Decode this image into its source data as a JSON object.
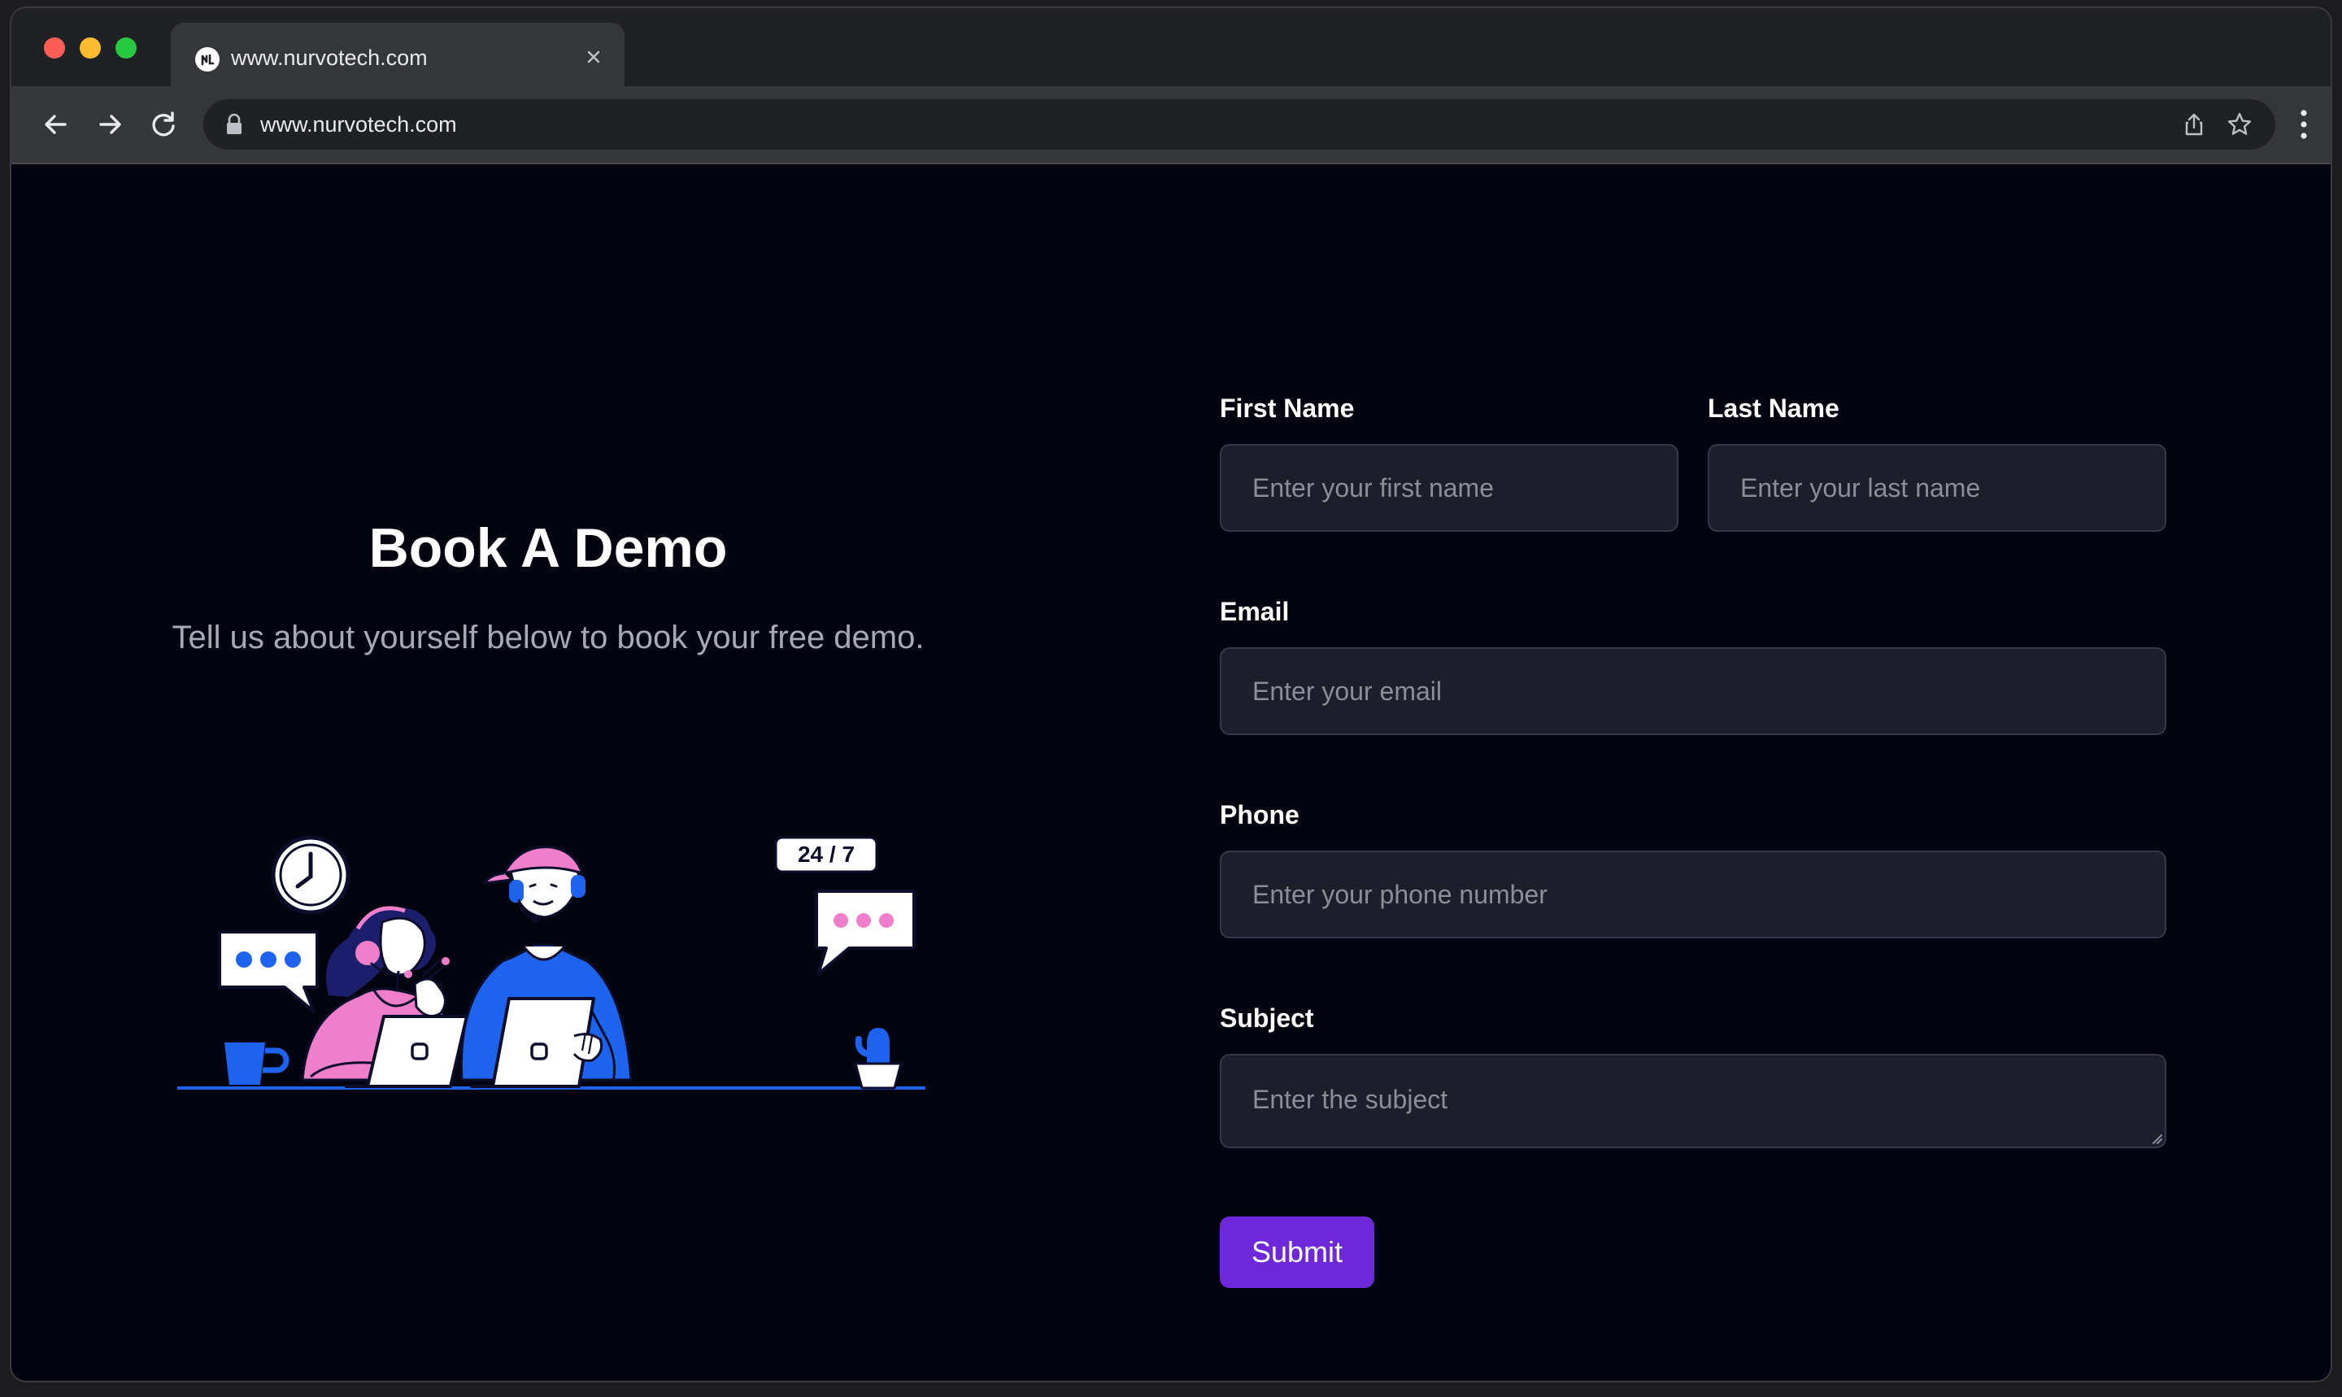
{
  "browser": {
    "tab_title": "www.nurvotech.com",
    "url": "www.nurvotech.com"
  },
  "hero": {
    "title": "Book A Demo",
    "subtitle": "Tell us about yourself below to book your free demo.",
    "illustration_badge": "24 / 7"
  },
  "form": {
    "first_name": {
      "label": "First Name",
      "value": "",
      "placeholder": "Enter your first name"
    },
    "last_name": {
      "label": "Last Name",
      "value": "",
      "placeholder": "Enter your last name"
    },
    "email": {
      "label": "Email",
      "value": "",
      "placeholder": "Enter your email"
    },
    "phone": {
      "label": "Phone",
      "value": "",
      "placeholder": "Enter your phone number"
    },
    "subject": {
      "label": "Subject",
      "value": "",
      "placeholder": "Enter the subject"
    },
    "submit_label": "Submit"
  },
  "colors": {
    "page_background": "#03040f",
    "input_background": "#1c1f2b",
    "accent": "#6d28d9",
    "illustration_pink": "#ef7ecb",
    "illustration_blue": "#1e63ee"
  }
}
